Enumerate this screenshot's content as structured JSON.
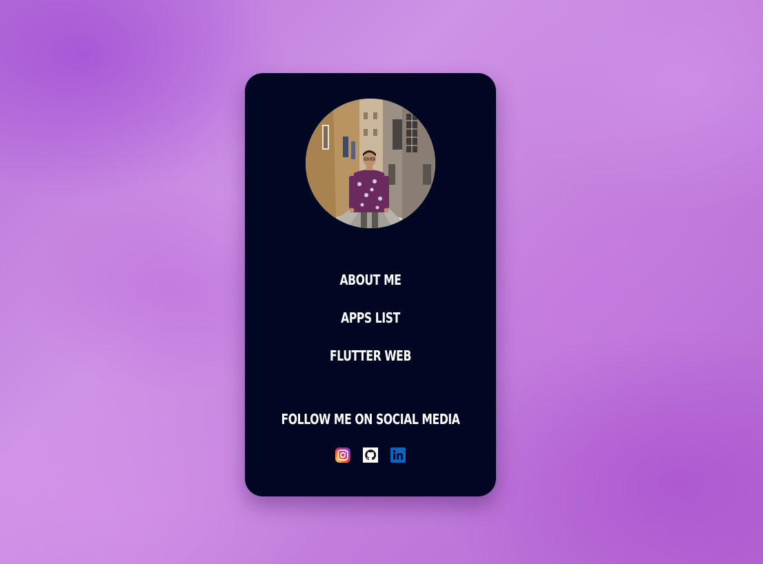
{
  "profile": {
    "avatar_icon": "profile-photo"
  },
  "menu": {
    "items": [
      {
        "label": "ABOUT ME"
      },
      {
        "label": "APPS LIST"
      },
      {
        "label": "FLUTTER WEB"
      }
    ]
  },
  "social": {
    "heading": "FOLLOW ME ON SOCIAL MEDIA",
    "icons": [
      {
        "icon": "instagram-icon"
      },
      {
        "icon": "github-icon"
      },
      {
        "icon": "linkedin-icon"
      }
    ]
  },
  "colors": {
    "card_background": "#010723",
    "text": "#ffffff",
    "page_background": "#c27ddc",
    "linkedin_blue": "#0a66c2"
  }
}
